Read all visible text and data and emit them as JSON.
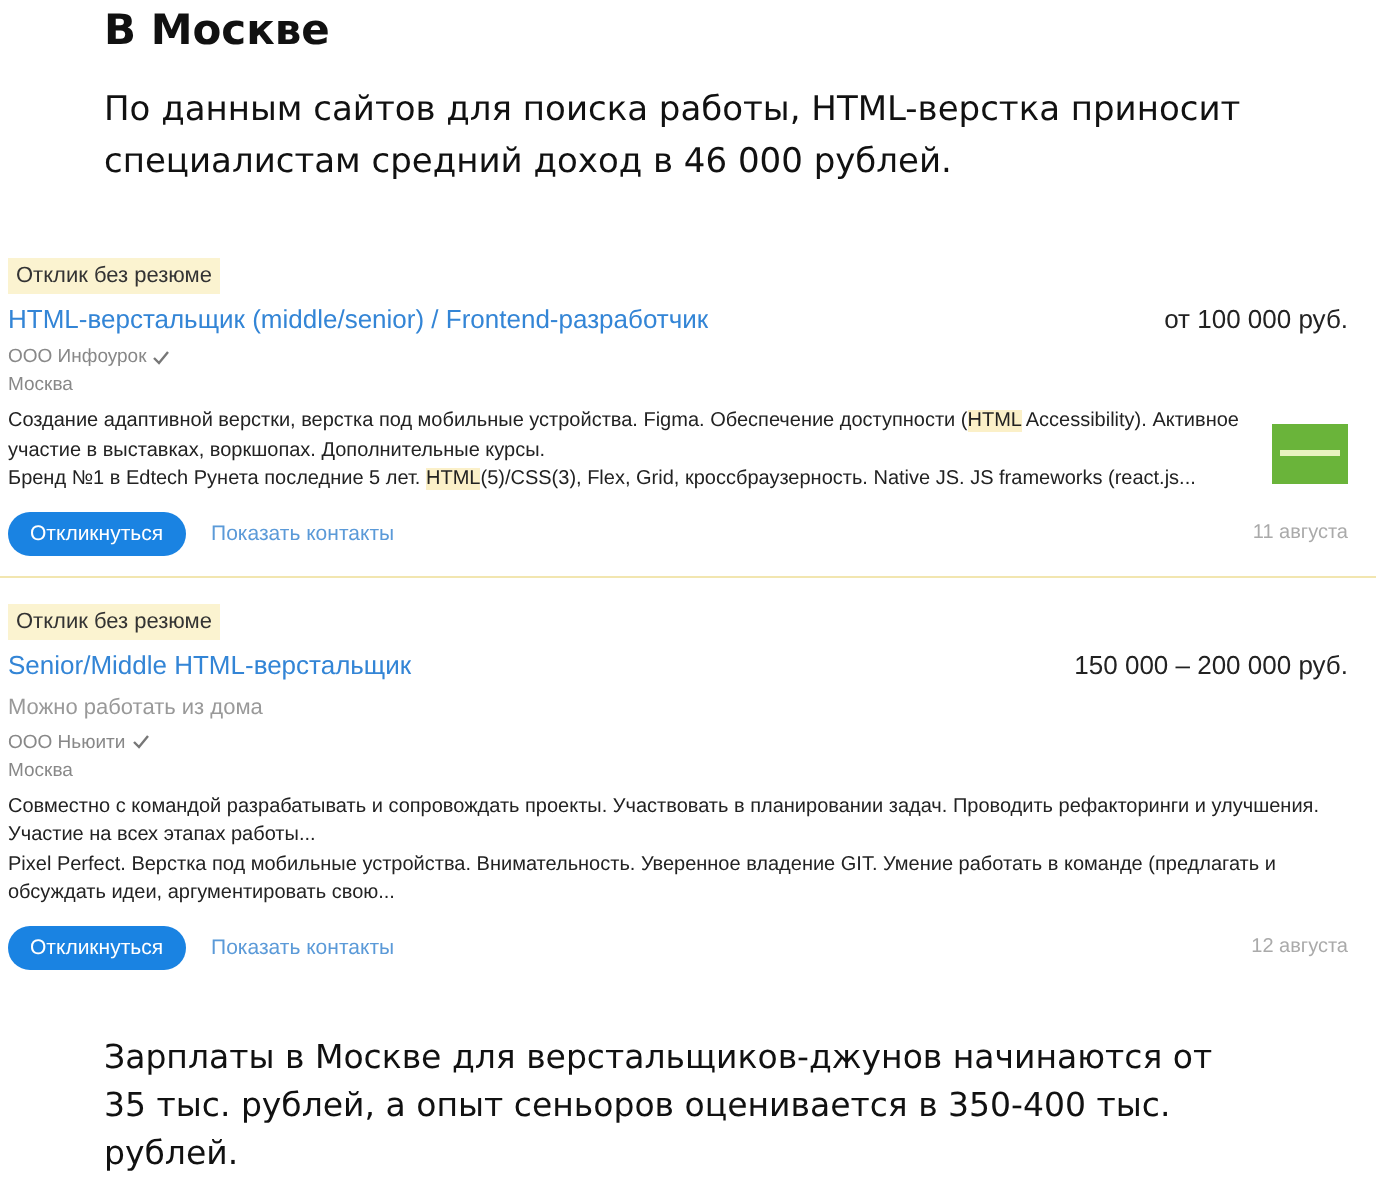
{
  "heading": "В Москве",
  "intro": "По данным сайтов для поиска работы, HTML-верстка приносит специалистам средний доход в 46 000 рублей.",
  "vacancies": [
    {
      "badge": "Отклик без резюме",
      "title": "HTML-верстальщик (middle/senior) / Frontend-разработчик",
      "salary": "от 100 000 руб.",
      "company": "ООО Инфоурок",
      "verified": true,
      "city": "Москва",
      "logo": true,
      "description": [
        "Создание адаптивной верстки, верстка под мобильные устройства. Figma. Обеспечение доступности (**HTML** Accessibility). Активное участие в выставках, воркшопах. Дополнительные курсы.",
        "Бренд №1 в Edtech Рунета последние 5 лет. **HTML**(5)/CSS(3), Flex, Grid, кроссбраузерность. Native JS. JS frameworks (react.js..."
      ],
      "respond": "Откликнуться",
      "contacts": "Показать контакты",
      "date": "11 августа"
    },
    {
      "badge": "Отклик без резюме",
      "title": "Senior/Middle HTML-верстальщик",
      "salary": "150 000 – 200 000 руб.",
      "remote": "Можно работать из дома",
      "company": "ООО Ньюити",
      "verified": true,
      "city": "Москва",
      "description": [
        "Совместно с командой разрабатывать и сопровождать проекты. Участвовать в планировании задач. Проводить рефакторинги и улучшения. Участие на всех этапах работы...",
        "Pixel Perfect. Верстка под мобильные устройства. Внимательность. Уверенное владение GIT. Умение работать в команде (предлагать и обсуждать идеи, аргументировать свою..."
      ],
      "respond": "Откликнуться",
      "contacts": "Показать контакты",
      "date": "12 августа"
    }
  ],
  "outro": "Зарплаты в Москве для верстальщиков-джунов начинаются от 35 тыс. рублей, а опыт сеньоров оценивается в 350-400 тыс. рублей."
}
